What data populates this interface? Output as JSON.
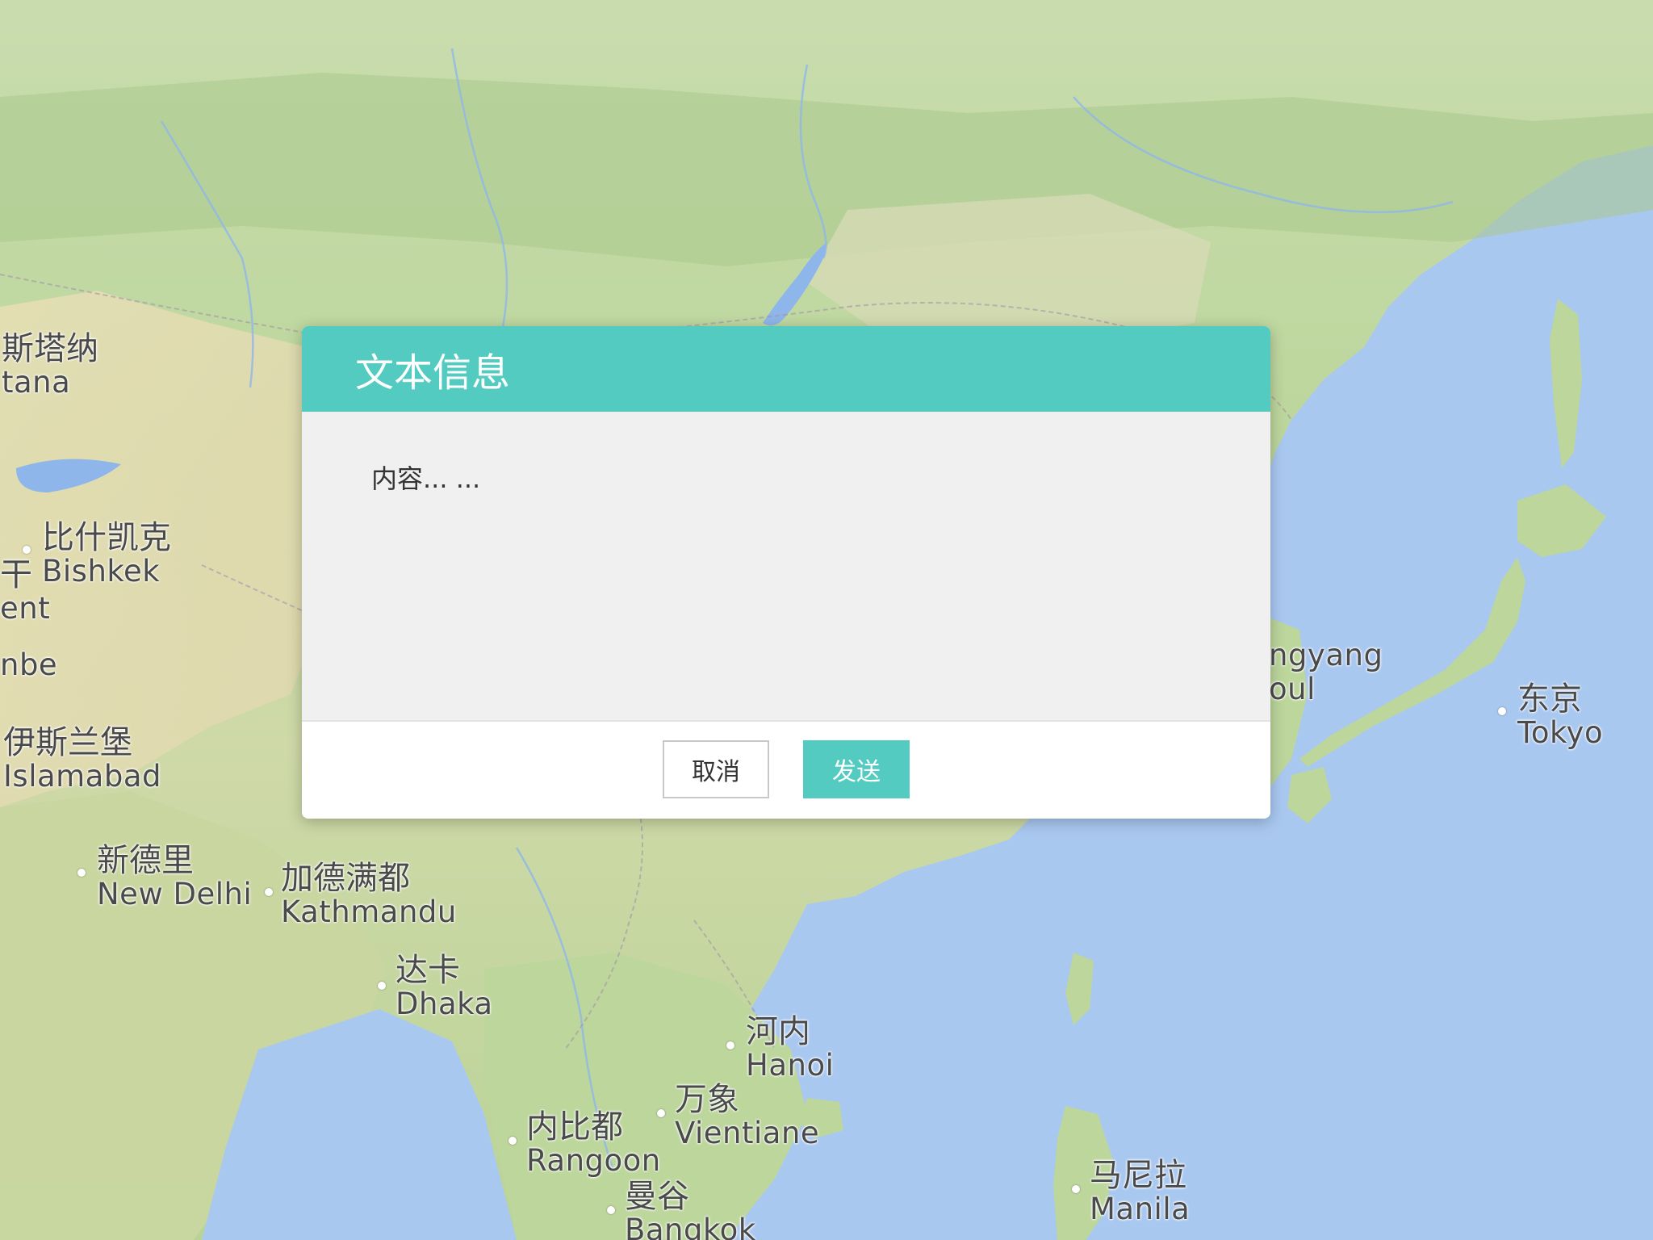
{
  "colors": {
    "accent": "#54cbc1",
    "ocean": "#a9c8f0",
    "dialog_body_bg": "#f0f0f0"
  },
  "map": {
    "labels": [
      {
        "id": "astana",
        "cn": "斯塔纳",
        "en": "tana"
      },
      {
        "id": "bishkek",
        "cn": "比什凯克",
        "en": "Bishkek"
      },
      {
        "id": "tashkent",
        "cn": "干",
        "en": "ent"
      },
      {
        "id": "dushanbe",
        "cn": "",
        "en": "nbe"
      },
      {
        "id": "islamabad",
        "cn": "伊斯兰堡",
        "en": "Islamabad"
      },
      {
        "id": "new-delhi",
        "cn": "新德里",
        "en": "New Delhi"
      },
      {
        "id": "kathmandu",
        "cn": "加德满都",
        "en": "Kathmandu"
      },
      {
        "id": "dhaka",
        "cn": "达卡",
        "en": "Dhaka"
      },
      {
        "id": "hanoi",
        "cn": "河内",
        "en": "Hanoi"
      },
      {
        "id": "vientiane",
        "cn": "万象",
        "en": "Vientiane"
      },
      {
        "id": "rangoon",
        "cn": "内比都",
        "en": "Rangoon"
      },
      {
        "id": "bangkok",
        "cn": "曼谷",
        "en": "Bangkok"
      },
      {
        "id": "manila",
        "cn": "马尼拉",
        "en": "Manila"
      },
      {
        "id": "tokyo",
        "cn": "东京",
        "en": "Tokyo"
      },
      {
        "id": "pyongyang-seoul",
        "cn": "",
        "en": "ngyang"
      },
      {
        "id": "seoul",
        "cn": "",
        "en": "oul"
      }
    ]
  },
  "dialog": {
    "title": "文本信息",
    "content": "内容... ...",
    "cancel_label": "取消",
    "send_label": "发送"
  }
}
